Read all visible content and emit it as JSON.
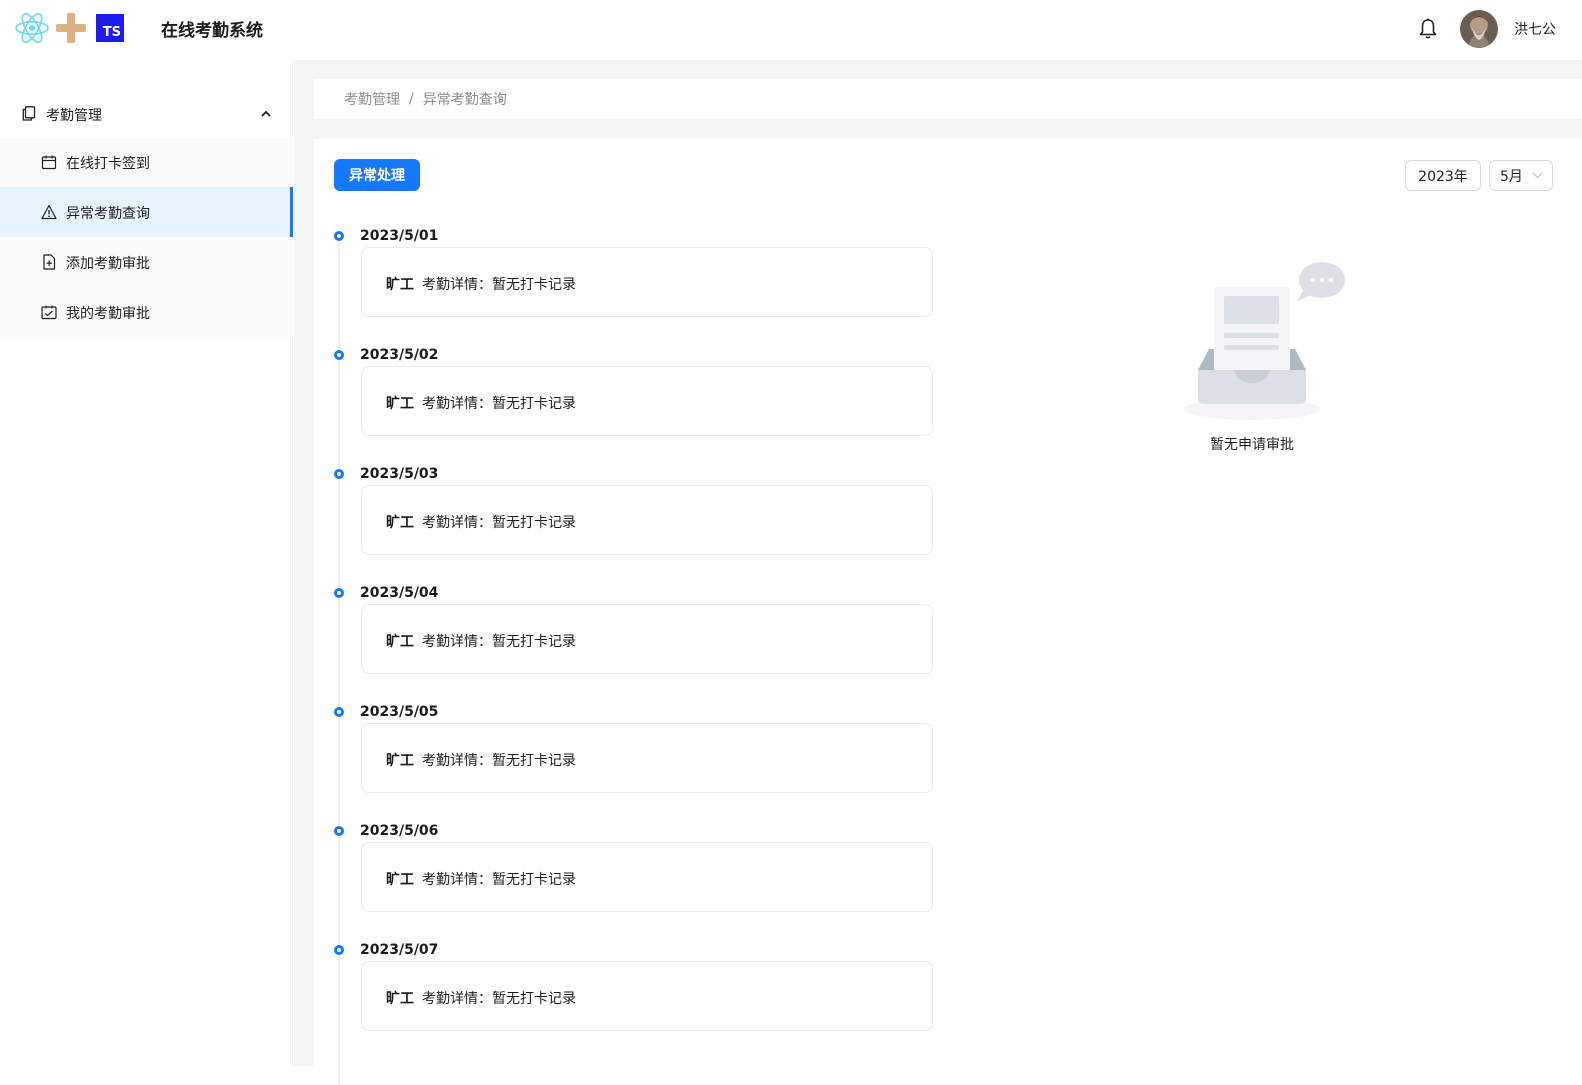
{
  "header": {
    "app_title": "在线考勤系统",
    "logo_ts_text": "TS",
    "user_name": "洪七公",
    "icons": [
      "react-logo-icon",
      "plus-icon",
      "typescript-logo-icon",
      "bell-icon",
      "avatar"
    ]
  },
  "sidebar": {
    "group_label": "考勤管理",
    "items": [
      {
        "label": "在线打卡签到",
        "icon": "calendar-icon",
        "active": false
      },
      {
        "label": "异常考勤查询",
        "icon": "warning-icon",
        "active": true
      },
      {
        "label": "添加考勤审批",
        "icon": "file-add-icon",
        "active": false
      },
      {
        "label": "我的考勤审批",
        "icon": "schedule-icon",
        "active": false
      }
    ]
  },
  "breadcrumb": {
    "parent": "考勤管理",
    "separator": "/",
    "current": "异常考勤查询"
  },
  "toolbar": {
    "action_button": "异常处理",
    "year": "2023年",
    "month": "5月"
  },
  "timeline": [
    {
      "date": "2023/5/01",
      "tag": "旷工",
      "detail": "考勤详情：暂无打卡记录"
    },
    {
      "date": "2023/5/02",
      "tag": "旷工",
      "detail": "考勤详情：暂无打卡记录"
    },
    {
      "date": "2023/5/03",
      "tag": "旷工",
      "detail": "考勤详情：暂无打卡记录"
    },
    {
      "date": "2023/5/04",
      "tag": "旷工",
      "detail": "考勤详情：暂无打卡记录"
    },
    {
      "date": "2023/5/05",
      "tag": "旷工",
      "detail": "考勤详情：暂无打卡记录"
    },
    {
      "date": "2023/5/06",
      "tag": "旷工",
      "detail": "考勤详情：暂无打卡记录"
    },
    {
      "date": "2023/5/07",
      "tag": "旷工",
      "detail": "考勤详情：暂无打卡记录"
    }
  ],
  "empty_state": {
    "text": "暂无申请审批",
    "icon": "empty-inbox-icon"
  },
  "colors": {
    "primary": "#1677ff",
    "active_bg": "#e6f4ff",
    "content_bg": "#f5f5f5",
    "ts_blue": "#1c1cf0",
    "plus_tan": "#d9b382",
    "react_cyan": "#61dafb"
  }
}
